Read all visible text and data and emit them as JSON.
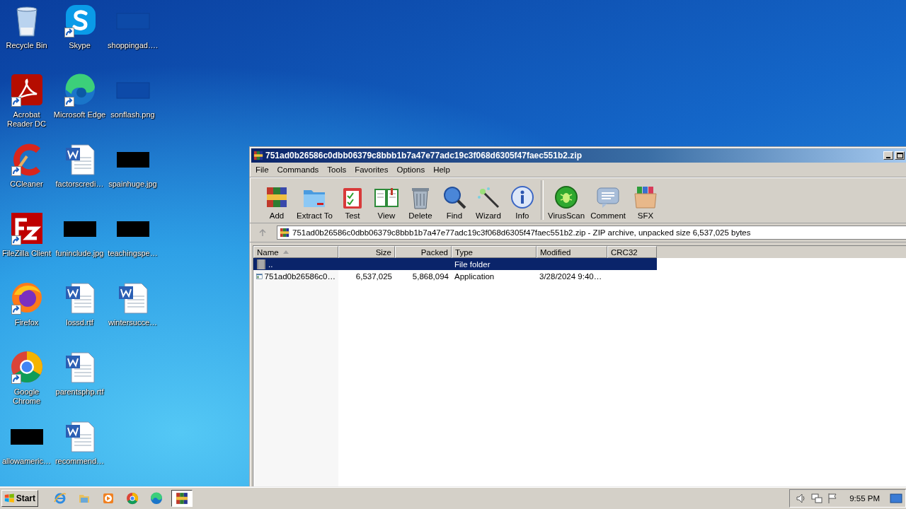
{
  "desktop_icons": [
    {
      "label": "Recycle Bin",
      "kind": "recycle",
      "shortcut": false
    },
    {
      "label": "Acrobat Reader DC",
      "kind": "acrobat",
      "shortcut": true
    },
    {
      "label": "CCleaner",
      "kind": "ccleaner",
      "shortcut": true
    },
    {
      "label": "FileZilla Client",
      "kind": "filezilla",
      "shortcut": true
    },
    {
      "label": "Firefox",
      "kind": "firefox",
      "shortcut": true
    },
    {
      "label": "Google Chrome",
      "kind": "chrome",
      "shortcut": true
    },
    {
      "label": "allowameric…",
      "kind": "image-dark",
      "shortcut": false
    },
    {
      "label": "Skype",
      "kind": "skype",
      "shortcut": true
    },
    {
      "label": "Microsoft Edge",
      "kind": "edge",
      "shortcut": true
    },
    {
      "label": "factorscredi…",
      "kind": "word",
      "shortcut": false
    },
    {
      "label": "funinclude.jpg",
      "kind": "image-dark",
      "shortcut": false
    },
    {
      "label": "lossd.rtf",
      "kind": "word",
      "shortcut": false
    },
    {
      "label": "parentsphp.rtf",
      "kind": "word",
      "shortcut": false
    },
    {
      "label": "recommend…",
      "kind": "word",
      "shortcut": false
    },
    {
      "label": "shoppingad….",
      "kind": "image-blank",
      "shortcut": false
    },
    {
      "label": "sonflash.png",
      "kind": "image-blank",
      "shortcut": false
    },
    {
      "label": "spainhuge.jpg",
      "kind": "image-dark",
      "shortcut": false
    },
    {
      "label": "teachingspe…",
      "kind": "image-dark",
      "shortcut": false
    },
    {
      "label": "wintersucce…",
      "kind": "word",
      "shortcut": false
    }
  ],
  "window": {
    "title": "751ad0b26586c0dbb06379c8bbb1b7a47e77adc19c3f068d6305f47faec551b2.zip",
    "menu": [
      "File",
      "Commands",
      "Tools",
      "Favorites",
      "Options",
      "Help"
    ],
    "toolbar": [
      {
        "label": "Add",
        "kind": "add"
      },
      {
        "label": "Extract To",
        "kind": "extract"
      },
      {
        "label": "Test",
        "kind": "test"
      },
      {
        "label": "View",
        "kind": "view"
      },
      {
        "label": "Delete",
        "kind": "delete"
      },
      {
        "label": "Find",
        "kind": "find"
      },
      {
        "label": "Wizard",
        "kind": "wizard"
      },
      {
        "label": "Info",
        "kind": "info"
      },
      {
        "label": "VirusScan",
        "kind": "virusscan"
      },
      {
        "label": "Comment",
        "kind": "comment"
      },
      {
        "label": "SFX",
        "kind": "sfx"
      }
    ],
    "address": "751ad0b26586c0dbb06379c8bbb1b7a47e77adc19c3f068d6305f47faec551b2.zip - ZIP archive, unpacked size 6,537,025 bytes",
    "table": {
      "columns": [
        "Name",
        "Size",
        "Packed",
        "Type",
        "Modified",
        "CRC32"
      ],
      "rows": [
        {
          "kind": "folder",
          "selected": true,
          "cells": [
            "..",
            "",
            "",
            "File folder",
            "",
            ""
          ]
        },
        {
          "kind": "app",
          "selected": false,
          "cells": [
            "751ad0b26586c0…",
            "6,537,025",
            "5,868,094",
            "Application",
            "3/28/2024 9:40…",
            ""
          ]
        }
      ]
    }
  },
  "taskbar": {
    "start": "Start",
    "apps": [
      {
        "kind": "ie",
        "selected": false
      },
      {
        "kind": "explorer",
        "selected": false
      },
      {
        "kind": "media",
        "selected": false
      },
      {
        "kind": "chrome",
        "selected": false
      },
      {
        "kind": "edge",
        "selected": false
      },
      {
        "kind": "winrar",
        "selected": true
      }
    ],
    "clock": "9:55 PM"
  }
}
